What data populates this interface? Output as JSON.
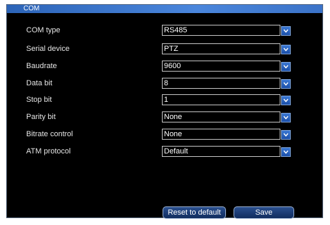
{
  "window": {
    "title": "COM"
  },
  "fields": [
    {
      "label": "COM type",
      "value": "RS485"
    },
    {
      "label": "Serial device",
      "value": "PTZ"
    },
    {
      "label": "Baudrate",
      "value": "9600"
    },
    {
      "label": "Data bit",
      "value": "8"
    },
    {
      "label": "Stop bit",
      "value": "1"
    },
    {
      "label": "Parity bit",
      "value": "None"
    },
    {
      "label": "Bitrate control",
      "value": "None"
    },
    {
      "label": "ATM protocol",
      "value": "Default"
    }
  ],
  "buttons": {
    "reset_label": "Reset to default",
    "save_label": "Save"
  },
  "icons": {
    "dropdown": "chevron-down-icon"
  },
  "colors": {
    "background": "#000000",
    "titlebar": "#3b73c8",
    "arrow_button": "#2a64c0"
  }
}
